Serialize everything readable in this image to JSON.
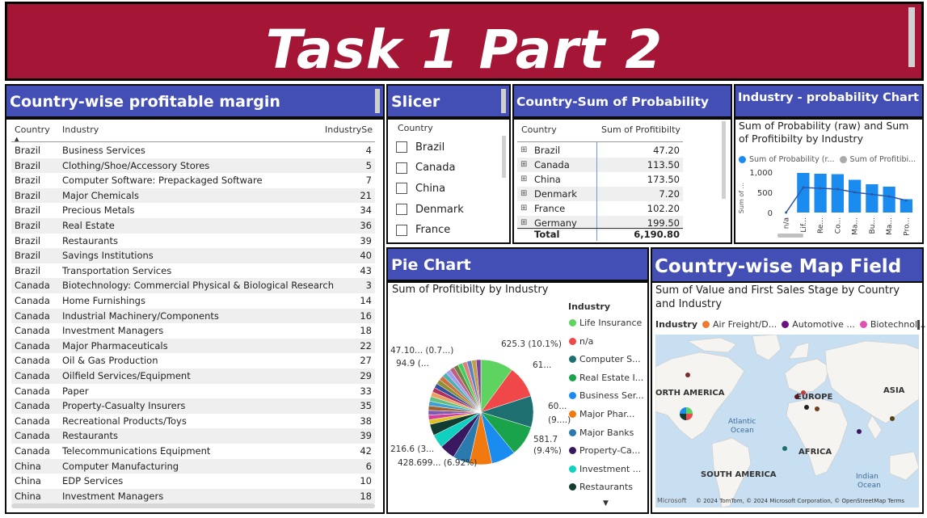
{
  "title": "Task 1 Part 2",
  "table1": {
    "header": "Country-wise profitable margin",
    "columns": [
      "Country",
      "Industry",
      "IndustrySe"
    ],
    "rows": [
      [
        "Brazil",
        "Business Services",
        "4"
      ],
      [
        "Brazil",
        "Clothing/Shoe/Accessory Stores",
        "5"
      ],
      [
        "Brazil",
        "Computer Software: Prepackaged Software",
        "7"
      ],
      [
        "Brazil",
        "Major Chemicals",
        "21"
      ],
      [
        "Brazil",
        "Precious Metals",
        "34"
      ],
      [
        "Brazil",
        "Real Estate",
        "36"
      ],
      [
        "Brazil",
        "Restaurants",
        "39"
      ],
      [
        "Brazil",
        "Savings Institutions",
        "40"
      ],
      [
        "Brazil",
        "Transportation Services",
        "43"
      ],
      [
        "Canada",
        "Biotechnology: Commercial Physical & Biological Research",
        "3"
      ],
      [
        "Canada",
        "Home Furnishings",
        "14"
      ],
      [
        "Canada",
        "Industrial Machinery/Components",
        "16"
      ],
      [
        "Canada",
        "Investment Managers",
        "18"
      ],
      [
        "Canada",
        "Major Pharmaceuticals",
        "22"
      ],
      [
        "Canada",
        "Oil & Gas Production",
        "27"
      ],
      [
        "Canada",
        "Oilfield Services/Equipment",
        "29"
      ],
      [
        "Canada",
        "Paper",
        "33"
      ],
      [
        "Canada",
        "Property-Casualty Insurers",
        "35"
      ],
      [
        "Canada",
        "Recreational Products/Toys",
        "38"
      ],
      [
        "Canada",
        "Restaurants",
        "39"
      ],
      [
        "Canada",
        "Telecommunications Equipment",
        "42"
      ],
      [
        "China",
        "Computer Manufacturing",
        "6"
      ],
      [
        "China",
        "EDP Services",
        "10"
      ],
      [
        "China",
        "Investment Managers",
        "18"
      ]
    ]
  },
  "slicer": {
    "header": "Slicer",
    "field": "Country",
    "items": [
      "Brazil",
      "Canada",
      "China",
      "Denmark",
      "France"
    ]
  },
  "matrix": {
    "header": "Country-Sum of Probability",
    "col1": "Country",
    "col2": "Sum of Profitibilty",
    "rows": [
      [
        "Brazil",
        "47.20"
      ],
      [
        "Canada",
        "113.50"
      ],
      [
        "China",
        "173.50"
      ],
      [
        "Denmark",
        "7.20"
      ],
      [
        "France",
        "102.20"
      ],
      [
        "Germany",
        "199.50"
      ]
    ],
    "total_label": "Total",
    "total_value": "6,190.80"
  },
  "industry_chart": {
    "header": "Industry - probability Chart",
    "title": "Sum of Probability (raw) and Sum of Profitibilty by Industry",
    "legend1": "Sum of Probability (r...",
    "legend2": "Sum of Profitibi...",
    "ylabel": "Sum of ...",
    "yticks": [
      "1,000",
      "500",
      "0"
    ],
    "colors": {
      "bar": "#1a8cf0",
      "line": "#2b59a8",
      "legend2": "#aaaaaa"
    }
  },
  "chart_data": {
    "type": "bar",
    "categories": [
      "n/a",
      "Lif...",
      "Re...",
      "Co...",
      "Ma...",
      "Bu...",
      "Ma...",
      "Pro..."
    ],
    "series": [
      {
        "name": "Sum of Probability (r...",
        "values": [
          0,
          980,
          960,
          950,
          810,
          700,
          640,
          330
        ]
      },
      {
        "name": "Sum of Profitibi...",
        "values": [
          0,
          620,
          600,
          580,
          500,
          450,
          400,
          300
        ]
      }
    ],
    "ylim": [
      0,
      1000
    ]
  },
  "pie": {
    "header": "Pie Chart",
    "title": "Sum of Profitibilty by Industry",
    "legend_title": "Industry",
    "legend": [
      {
        "label": "Life Insurance",
        "color": "#5fd35f"
      },
      {
        "label": "n/a",
        "color": "#f04848"
      },
      {
        "label": "Computer S...",
        "color": "#1e7070"
      },
      {
        "label": "Real Estate I...",
        "color": "#1aa34a"
      },
      {
        "label": "Business Ser...",
        "color": "#1a8cf0"
      },
      {
        "label": "Major Phar...",
        "color": "#f07a10"
      },
      {
        "label": "Major Banks",
        "color": "#2a7ab0"
      },
      {
        "label": "Property-Ca...",
        "color": "#3a1860"
      },
      {
        "label": "Investment ...",
        "color": "#10d0c0"
      },
      {
        "label": "Restaurants",
        "color": "#123c30"
      }
    ],
    "labels": [
      "625.3 (10.1%)",
      "61...",
      "60...",
      "(9....)",
      "581.7",
      "(9.4%)",
      "428.699... (6.92%)",
      "216.6 (3...",
      "94.9 (...",
      "47.10... (0.7...)"
    ]
  },
  "map": {
    "header": "Country-wise Map Field",
    "title": "Sum of Value and First Sales Stage by Country and Industry",
    "legend_title": "Industry",
    "legend": [
      {
        "label": "Air Freight/D...",
        "color": "#f07a30"
      },
      {
        "label": "Automotive ...",
        "color": "#6a1080"
      },
      {
        "label": "Biotechnol...",
        "color": "#e050b0"
      }
    ],
    "regions": [
      "ORTH AMERICA",
      "EUROPE",
      "ASIA",
      "Atlantic Ocean",
      "AFRICA",
      "SOUTH AMERICA",
      "Indian Ocean"
    ],
    "attribution": "© 2024 TomTom, © 2024 Microsoft Corporation, © OpenStreetMap  Terms",
    "brand": "Microsoft"
  }
}
